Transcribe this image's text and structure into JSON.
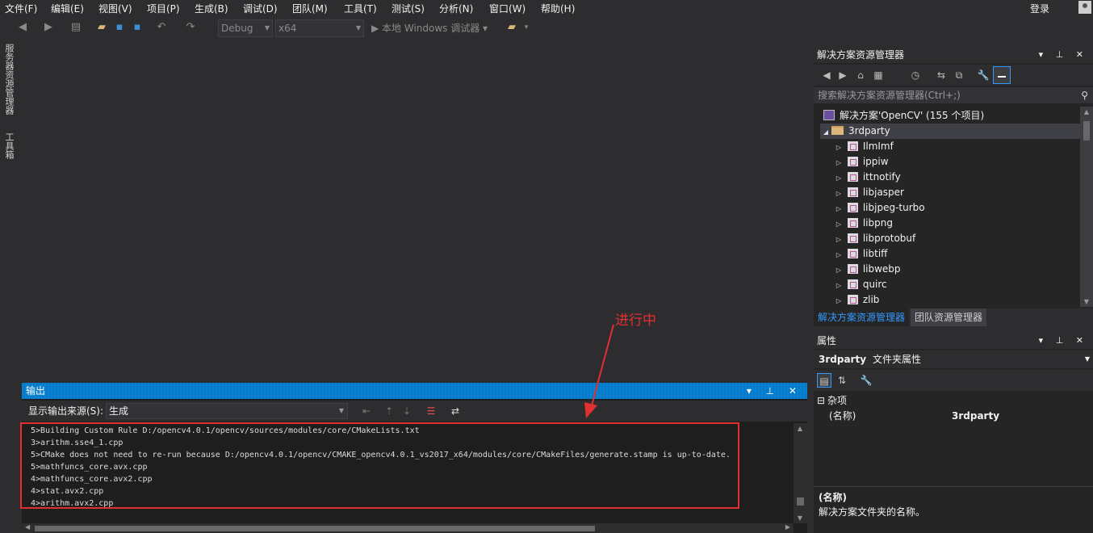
{
  "menu": {
    "items": [
      "文件(F)",
      "编辑(E)",
      "视图(V)",
      "项目(P)",
      "生成(B)",
      "调试(D)",
      "团队(M)",
      "工具(T)",
      "测试(S)",
      "分析(N)",
      "窗口(W)",
      "帮助(H)"
    ],
    "login": "登录"
  },
  "toolbar": {
    "config": "Debug",
    "platform": "x64",
    "debugger": "▶ 本地 Windows 调试器 ▾"
  },
  "side_tabs": [
    "服务器资源管理器",
    "工具箱"
  ],
  "solution_explorer": {
    "title": "解决方案资源管理器",
    "search_placeholder": "搜索解决方案资源管理器(Ctrl+;)",
    "solution": "解决方案'OpenCV' (155 个项目)",
    "folder": "3rdparty",
    "projects": [
      "IlmImf",
      "ippiw",
      "ittnotify",
      "libjasper",
      "libjpeg-turbo",
      "libpng",
      "libprotobuf",
      "libtiff",
      "libwebp",
      "quirc",
      "zlib"
    ],
    "tabs": [
      "解决方案资源管理器",
      "团队资源管理器"
    ]
  },
  "properties": {
    "title": "属性",
    "object": "3rdparty",
    "object_type": "文件夹属性",
    "category": "杂项",
    "rows": [
      {
        "name": "(名称)",
        "value": "3rdparty"
      }
    ],
    "desc_title": "(名称)",
    "desc_text": "解决方案文件夹的名称。"
  },
  "output": {
    "title": "输出",
    "source_label": "显示输出来源(S):",
    "source_value": "生成",
    "lines": [
      "5>Building Custom Rule D:/opencv4.0.1/opencv/sources/modules/core/CMakeLists.txt",
      "3>arithm.sse4_1.cpp",
      "5>CMake does not need to re-run because D:/opencv4.0.1/opencv/CMAKE_opencv4.0.1_vs2017_x64/modules/core/CMakeFiles/generate.stamp is up-to-date.",
      "5>mathfuncs_core.avx.cpp",
      "4>mathfuncs_core.avx2.cpp",
      "4>stat.avx2.cpp",
      "4>arithm.avx2.cpp"
    ]
  },
  "annotation": {
    "label": "进行中",
    "color": "#e03030"
  },
  "colors": {
    "background": "#2d2d30",
    "accent": "#007acc",
    "link": "#3399ff"
  }
}
